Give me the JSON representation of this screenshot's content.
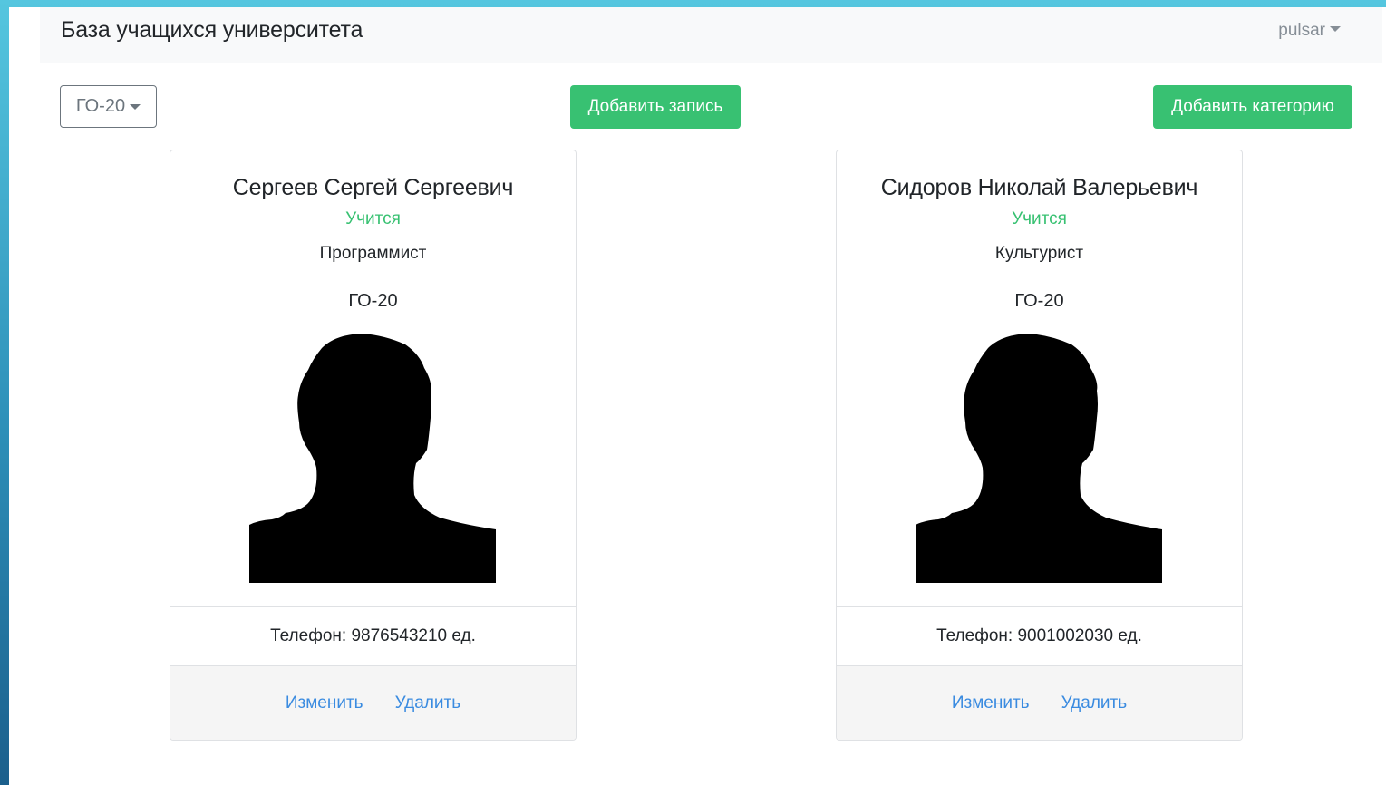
{
  "app": {
    "title": "База учащихся университета",
    "user": "pulsar"
  },
  "toolbar": {
    "group_filter": "ГО-20",
    "add_record_label": "Добавить запись",
    "add_category_label": "Добавить категорию"
  },
  "students": [
    {
      "name": "Сергеев Сергей Сергеевич",
      "status": "Учится",
      "profession": "Программист",
      "group": "ГО-20",
      "phone": "Телефон: 9876543210 ед.",
      "edit_label": "Изменить",
      "delete_label": "Удалить"
    },
    {
      "name": "Сидоров Николай Валерьевич",
      "status": "Учится",
      "profession": "Культурист",
      "group": "ГО-20",
      "phone": "Телефон: 9001002030 ед.",
      "edit_label": "Изменить",
      "delete_label": "Удалить"
    }
  ],
  "colors": {
    "accent_green": "#38c172",
    "link_blue": "#3a8be0",
    "silhouette": "#000000"
  },
  "icons": {
    "photo_placeholder": "person-silhouette-icon",
    "dropdown": "caret-down-icon"
  }
}
